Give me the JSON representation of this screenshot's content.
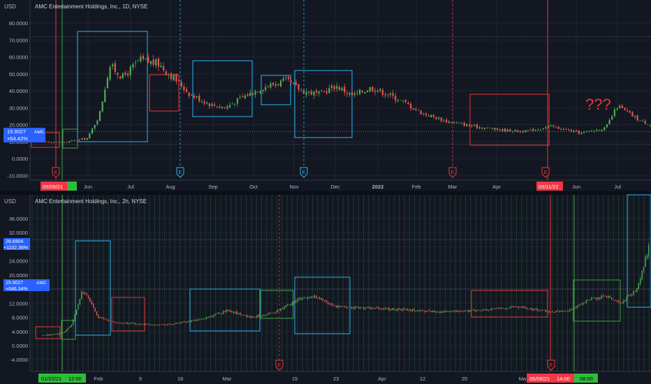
{
  "panels": {
    "top": {
      "title": "AMC Entertainment Holdings, Inc., 1D, NYSE",
      "currency": "USD",
      "yticks": [
        "80.0000",
        "70.0000",
        "60.0000",
        "50.0000",
        "40.0000",
        "30.0000",
        "20.0000",
        "10.0000",
        "0.0000",
        "-10.0000"
      ],
      "xticks": [
        "Jun",
        "Jul",
        "Aug",
        "Sep",
        "Oct",
        "Nov",
        "Dec",
        "2022",
        "Feb",
        "Mar",
        "Apr",
        "Jun",
        "Jul"
      ],
      "date_tags": [
        "05/06/21",
        "05/11/22"
      ],
      "price_tag": {
        "symbol": "AMC",
        "price": "15.9027",
        "change": "+64.42%"
      },
      "annotation": "???",
      "earnings_markers": [
        "E",
        "E",
        "E",
        "E",
        "E"
      ]
    },
    "bottom": {
      "title": "AMC Entertainment Holdings, Inc., 2h, NYSE",
      "currency": "USD",
      "yticks": [
        "36.0000",
        "32.0000",
        "28.0000",
        "24.0000",
        "20.0000",
        "16.0000",
        "12.0000",
        "8.0000",
        "4.0000",
        "0.0000",
        "-4.0000"
      ],
      "xticks": [
        "Feb",
        "9",
        "18",
        "Mar",
        "15",
        "23",
        "Apr",
        "12",
        "20",
        "Ma"
      ],
      "date_tags": [
        "01/22/21",
        "12:00",
        "05/06/21",
        "14:00",
        "08:00"
      ],
      "price_tags": [
        {
          "symbol": "",
          "price": "28.6904",
          "change": "+1102.36%"
        },
        {
          "symbol": "AMC",
          "price": "15.9027",
          "change": "+646.34%"
        }
      ],
      "earnings_markers": [
        "E",
        "E"
      ]
    }
  },
  "colors": {
    "bg": "#131722",
    "up": "#26a69a",
    "up_bright": "#4caf50",
    "down": "#ef5350",
    "box_blue": "#29b6f6",
    "box_red": "#e53935",
    "box_green": "#43a047",
    "tag_red": "#f23645",
    "tag_green": "#2ebd3a",
    "tag_blue": "#2962ff"
  },
  "chart_data": [
    {
      "type": "line",
      "title": "AMC Entertainment Holdings, Inc., 1D, NYSE",
      "ylabel": "USD",
      "ylim": [
        -12,
        86
      ],
      "grid": true,
      "series": [
        {
          "name": "AMC",
          "x": [
            "2021-04-20",
            "2021-05-06",
            "2021-05-20",
            "2021-05-27",
            "2021-06-02",
            "2021-06-10",
            "2021-06-20",
            "2021-07-01",
            "2021-07-10",
            "2021-07-20",
            "2021-08-01",
            "2021-08-10",
            "2021-08-20",
            "2021-09-01",
            "2021-09-15",
            "2021-09-25",
            "2021-10-05",
            "2021-10-15",
            "2021-10-25",
            "2021-11-05",
            "2021-11-15",
            "2021-11-25",
            "2021-12-05",
            "2021-12-20",
            "2022-01-05",
            "2022-01-20",
            "2022-02-05",
            "2022-02-20",
            "2022-03-10",
            "2022-03-25",
            "2022-04-01",
            "2022-04-15",
            "2022-05-01",
            "2022-05-15",
            "2022-06-01",
            "2022-06-20",
            "2022-07-01",
            "2022-07-20"
          ],
          "values": [
            10,
            9.5,
            12,
            26,
            55,
            48,
            58,
            56,
            48,
            38,
            32,
            30,
            36,
            42,
            46,
            40,
            38,
            43,
            37,
            42,
            38,
            33,
            27,
            22,
            19,
            17,
            16,
            19,
            15,
            18,
            31,
            22,
            17,
            13,
            12,
            13,
            12,
            15.9
          ]
        }
      ]
    },
    {
      "type": "line",
      "title": "AMC Entertainment Holdings, Inc., 2h, NYSE",
      "ylabel": "USD",
      "ylim": [
        -6,
        38
      ],
      "grid": true,
      "series": [
        {
          "name": "AMC",
          "x": [
            "2021-01-22",
            "2021-01-26",
            "2021-01-27",
            "2021-01-28",
            "2021-01-29",
            "2021-02-02",
            "2021-02-05",
            "2021-02-10",
            "2021-02-16",
            "2021-02-22",
            "2021-03-01",
            "2021-03-05",
            "2021-03-10",
            "2021-03-15",
            "2021-03-20",
            "2021-03-25",
            "2021-04-01",
            "2021-04-08",
            "2021-04-15",
            "2021-04-22",
            "2021-05-01",
            "2021-05-06",
            "2021-05-10",
            "2021-05-15",
            "2021-05-20",
            "2021-05-25",
            "2021-05-28",
            "2021-06-02"
          ],
          "values": [
            2.8,
            3.5,
            6,
            15,
            14,
            8,
            6.5,
            6,
            6,
            7.5,
            10,
            8,
            9.5,
            13,
            14,
            11,
            10.5,
            10,
            9.5,
            10,
            11,
            9.5,
            10,
            13,
            14,
            12,
            16,
            28.7
          ]
        }
      ]
    }
  ]
}
